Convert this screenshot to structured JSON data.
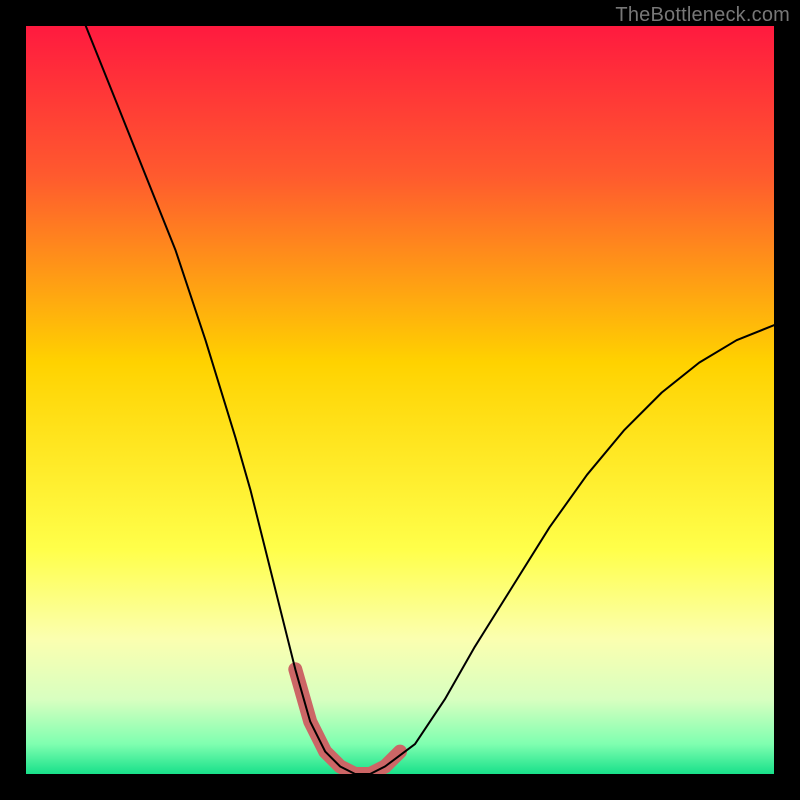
{
  "watermark": "TheBottleneck.com",
  "chart_data": {
    "type": "line",
    "title": "",
    "xlabel": "",
    "ylabel": "",
    "xlim": [
      0,
      100
    ],
    "ylim": [
      0,
      100
    ],
    "grid": false,
    "legend": false,
    "background": {
      "type": "vertical-gradient",
      "stops": [
        {
          "pct": 0,
          "color": "#ff1a3f"
        },
        {
          "pct": 20,
          "color": "#ff5a2e"
        },
        {
          "pct": 45,
          "color": "#ffd200"
        },
        {
          "pct": 70,
          "color": "#ffff4a"
        },
        {
          "pct": 82,
          "color": "#fbffb0"
        },
        {
          "pct": 90,
          "color": "#d8ffc0"
        },
        {
          "pct": 96,
          "color": "#7fffb0"
        },
        {
          "pct": 100,
          "color": "#18e08a"
        }
      ]
    },
    "series": [
      {
        "name": "bottleneck-curve",
        "stroke": "#000000",
        "stroke_width": 2,
        "x": [
          8,
          12,
          16,
          20,
          24,
          28,
          30,
          32,
          34,
          36,
          38,
          40,
          42,
          44,
          46,
          48,
          52,
          56,
          60,
          65,
          70,
          75,
          80,
          85,
          90,
          95,
          100
        ],
        "y": [
          100,
          90,
          80,
          70,
          58,
          45,
          38,
          30,
          22,
          14,
          7,
          3,
          1,
          0,
          0,
          1,
          4,
          10,
          17,
          25,
          33,
          40,
          46,
          51,
          55,
          58,
          60
        ]
      }
    ],
    "annotations": [
      {
        "name": "highlight-blob",
        "type": "path-stroke",
        "stroke": "#cc6666",
        "stroke_width": 14,
        "linecap": "round",
        "points_xy": [
          [
            36,
            14
          ],
          [
            38,
            7
          ],
          [
            40,
            3
          ],
          [
            42,
            1
          ],
          [
            44,
            0
          ],
          [
            46,
            0
          ],
          [
            48,
            1
          ],
          [
            50,
            3
          ]
        ]
      }
    ]
  }
}
